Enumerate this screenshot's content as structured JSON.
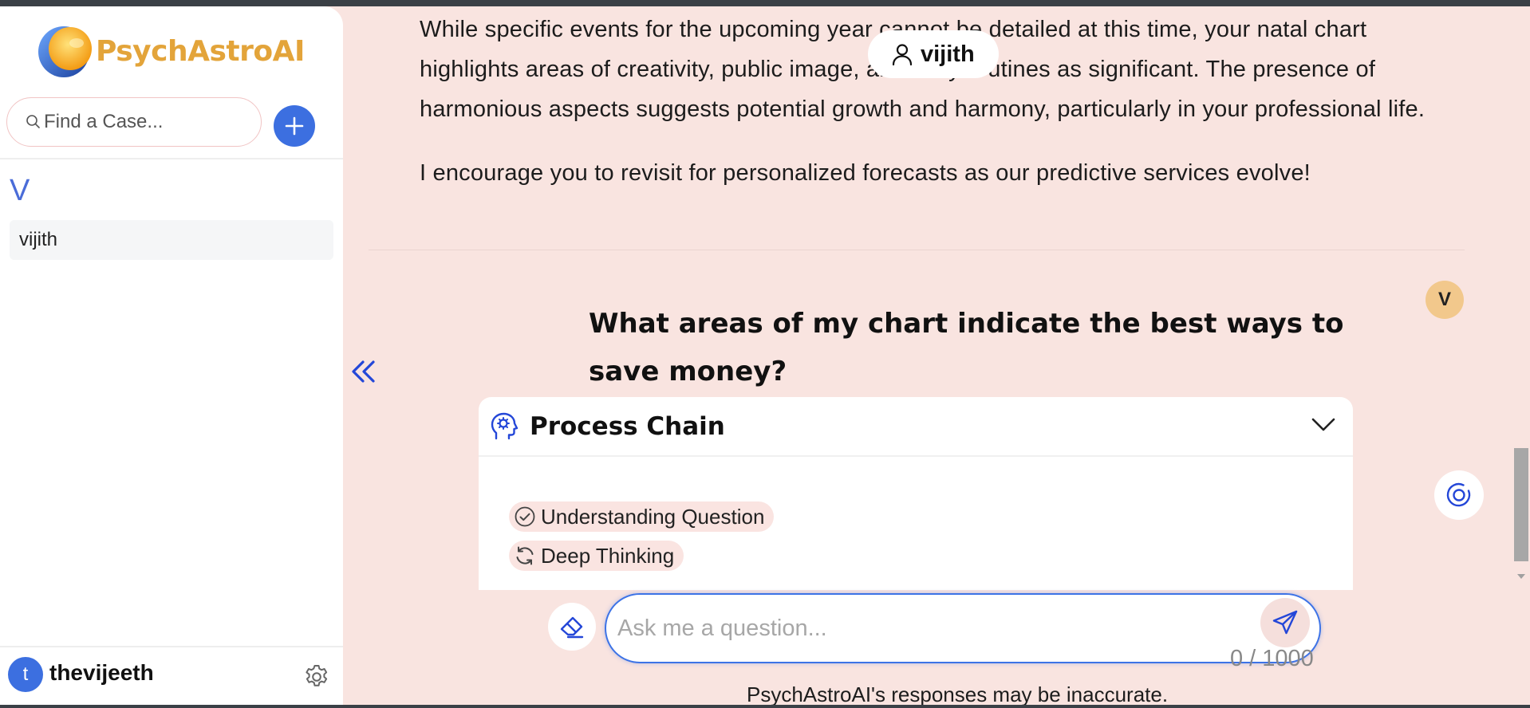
{
  "app": {
    "name": "PsychAstroAI",
    "brand_color": "#e3a43a",
    "accent_color": "#3c6fe0",
    "background_color": "#f9e4e0"
  },
  "sidebar": {
    "search_placeholder": "Find a Case...",
    "group_letter": "V",
    "cases": [
      "vijith"
    ],
    "user": {
      "initial": "t",
      "name": "thevijeeth"
    }
  },
  "chat": {
    "active_user_chip": "vijith",
    "previous_answer": [
      "While specific events for the upcoming year cannot be detailed at this time, your natal chart highlights areas of creativity, public image, and daily routines as significant. The presence of harmonious aspects suggests potential growth and harmony, particularly in your professional life.",
      "I encourage you to revisit for personalized forecasts as our predictive services evolve!"
    ],
    "question_avatar": "V",
    "question": "What areas of my chart indicate the best ways to save money?",
    "process_chain": {
      "title": "Process Chain",
      "steps": [
        {
          "label": "Understanding Question",
          "status": "done"
        },
        {
          "label": "Deep Thinking",
          "status": "in-progress"
        }
      ]
    }
  },
  "composer": {
    "placeholder": "Ask me a question...",
    "counter": "0 / 1000",
    "disclaimer": "PsychAstroAI's responses may be inaccurate."
  }
}
